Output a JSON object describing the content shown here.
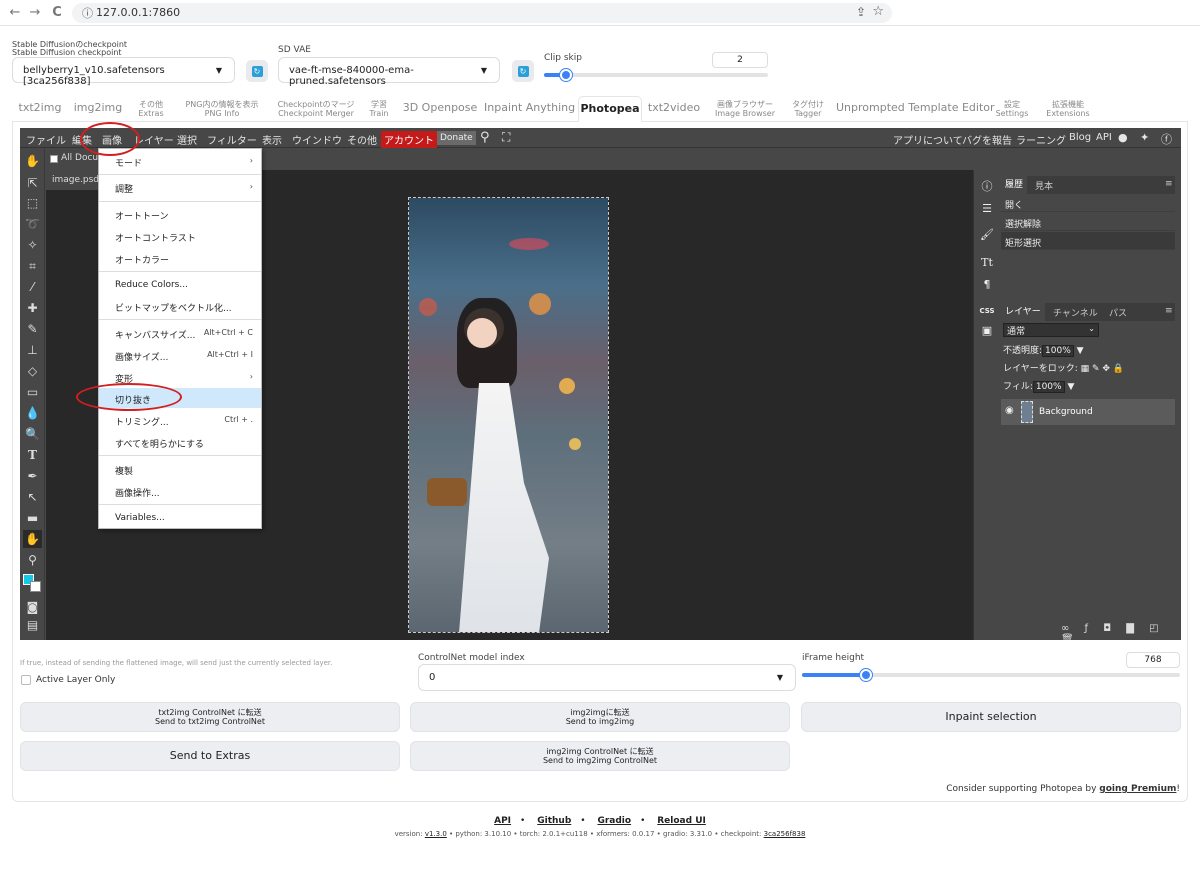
{
  "browser": {
    "back": "←",
    "forward": "→",
    "reload": "C",
    "url": "127.0.0.1:7860"
  },
  "top": {
    "ckpt_label1": "Stable Diffusionのcheckpoint",
    "ckpt_label2": "Stable Diffusion checkpoint",
    "ckpt_value": "bellyberry1_v10.safetensors [3ca256f838]",
    "vae_label": "SD VAE",
    "vae_value": "vae-ft-mse-840000-ema-pruned.safetensors",
    "clip_label": "Clip skip",
    "clip_value": "2",
    "clip_fraction": 0.1
  },
  "tabs": [
    {
      "a": "txt2img",
      "b": ""
    },
    {
      "a": "img2img",
      "b": ""
    },
    {
      "a": "その他",
      "b": "Extras"
    },
    {
      "a": "PNG内の情報を表示",
      "b": "PNG Info"
    },
    {
      "a": "Checkpointのマージ",
      "b": "Checkpoint Merger"
    },
    {
      "a": "学習",
      "b": "Train"
    },
    {
      "a": "3D Openpose",
      "b": ""
    },
    {
      "a": "Inpaint Anything",
      "b": ""
    },
    {
      "a": "Photopea",
      "b": ""
    },
    {
      "a": "txt2video",
      "b": ""
    },
    {
      "a": "画像ブラウザー",
      "b": "Image Browser"
    },
    {
      "a": "タグ付け",
      "b": "Tagger"
    },
    {
      "a": "Unprompted Template Editor",
      "b": ""
    },
    {
      "a": "設定",
      "b": "Settings"
    },
    {
      "a": "拡張機能",
      "b": "Extensions"
    }
  ],
  "photopea": {
    "menu": [
      "ファイル",
      "編集",
      "画像",
      "レイヤー",
      "選択",
      "フィルター",
      "表示",
      "ウインドウ",
      "その他"
    ],
    "account": "アカウント",
    "donate": "Donate",
    "right_menu": [
      "アプリについて",
      "バグを報告",
      "ラーニング",
      "Blog",
      "API"
    ],
    "all_documents": "All Docum",
    "doc_tab": "image.psd",
    "history_tabs": [
      "履歴",
      "見本"
    ],
    "history": [
      "開く",
      "選択解除",
      "矩形選択"
    ],
    "layer_tabs": [
      "レイヤー",
      "チャンネル",
      "パス"
    ],
    "blend": "通常",
    "opacity_label": "不透明度:",
    "opacity": "100%",
    "lock_label": "レイヤーをロック:",
    "fill_label": "フィル:",
    "fill": "100%",
    "layer_name": "Background",
    "ri_css": "CSS"
  },
  "dropdown": {
    "items": [
      {
        "label": "モード",
        "sc": "›"
      },
      {
        "label": "調整",
        "sc": "›"
      },
      {
        "label": "オートトーン",
        "sc": ""
      },
      {
        "label": "オートコントラスト",
        "sc": ""
      },
      {
        "label": "オートカラー",
        "sc": ""
      },
      {
        "label": "Reduce Colors...",
        "sc": ""
      },
      {
        "label": "ビットマップをベクトル化...",
        "sc": ""
      },
      {
        "label": "キャンバスサイズ...",
        "sc": "Alt+Ctrl + C"
      },
      {
        "label": "画像サイズ...",
        "sc": "Alt+Ctrl + I"
      },
      {
        "label": "変形",
        "sc": "›"
      },
      {
        "label": "切り抜き",
        "sc": ""
      },
      {
        "label": "トリミング...",
        "sc": "Ctrl + ."
      },
      {
        "label": "すべてを明らかにする",
        "sc": ""
      },
      {
        "label": "複製",
        "sc": ""
      },
      {
        "label": "画像操作...",
        "sc": ""
      },
      {
        "label": "Variables...",
        "sc": ""
      }
    ]
  },
  "bottom": {
    "note": "If true, instead of sending the flattened image, will send just the currently selected layer.",
    "active_layer": "Active Layer Only",
    "cn_label": "ControlNet model index",
    "cn_value": "0",
    "iframe_label": "iFrame height",
    "iframe_value": "768",
    "iframe_fraction": 0.17,
    "btn1a": "txt2img ControlNet に転送",
    "btn1b": "Send to txt2img ControlNet",
    "btn2a": "img2imgに転送",
    "btn2b": "Send to img2img",
    "btn3": "Inpaint selection",
    "btn4": "Send to Extras",
    "btn5a": "img2img ControlNet に転送",
    "btn5b": "Send to img2img ControlNet",
    "support_pre": "Consider supporting Photopea by ",
    "support_link": "going Premium",
    "support_post": "!"
  },
  "footer": {
    "links": [
      "API",
      "Github",
      "Gradio",
      "Reload UI"
    ],
    "ver_pre": "version: ",
    "version": "v1.3.0",
    "python": "  •  python: 3.10.10  •  torch: 2.0.1+cu118  •  xformers: 0.0.17  •  gradio: 3.31.0  •  checkpoint: ",
    "ckpt": "3ca256f838"
  }
}
